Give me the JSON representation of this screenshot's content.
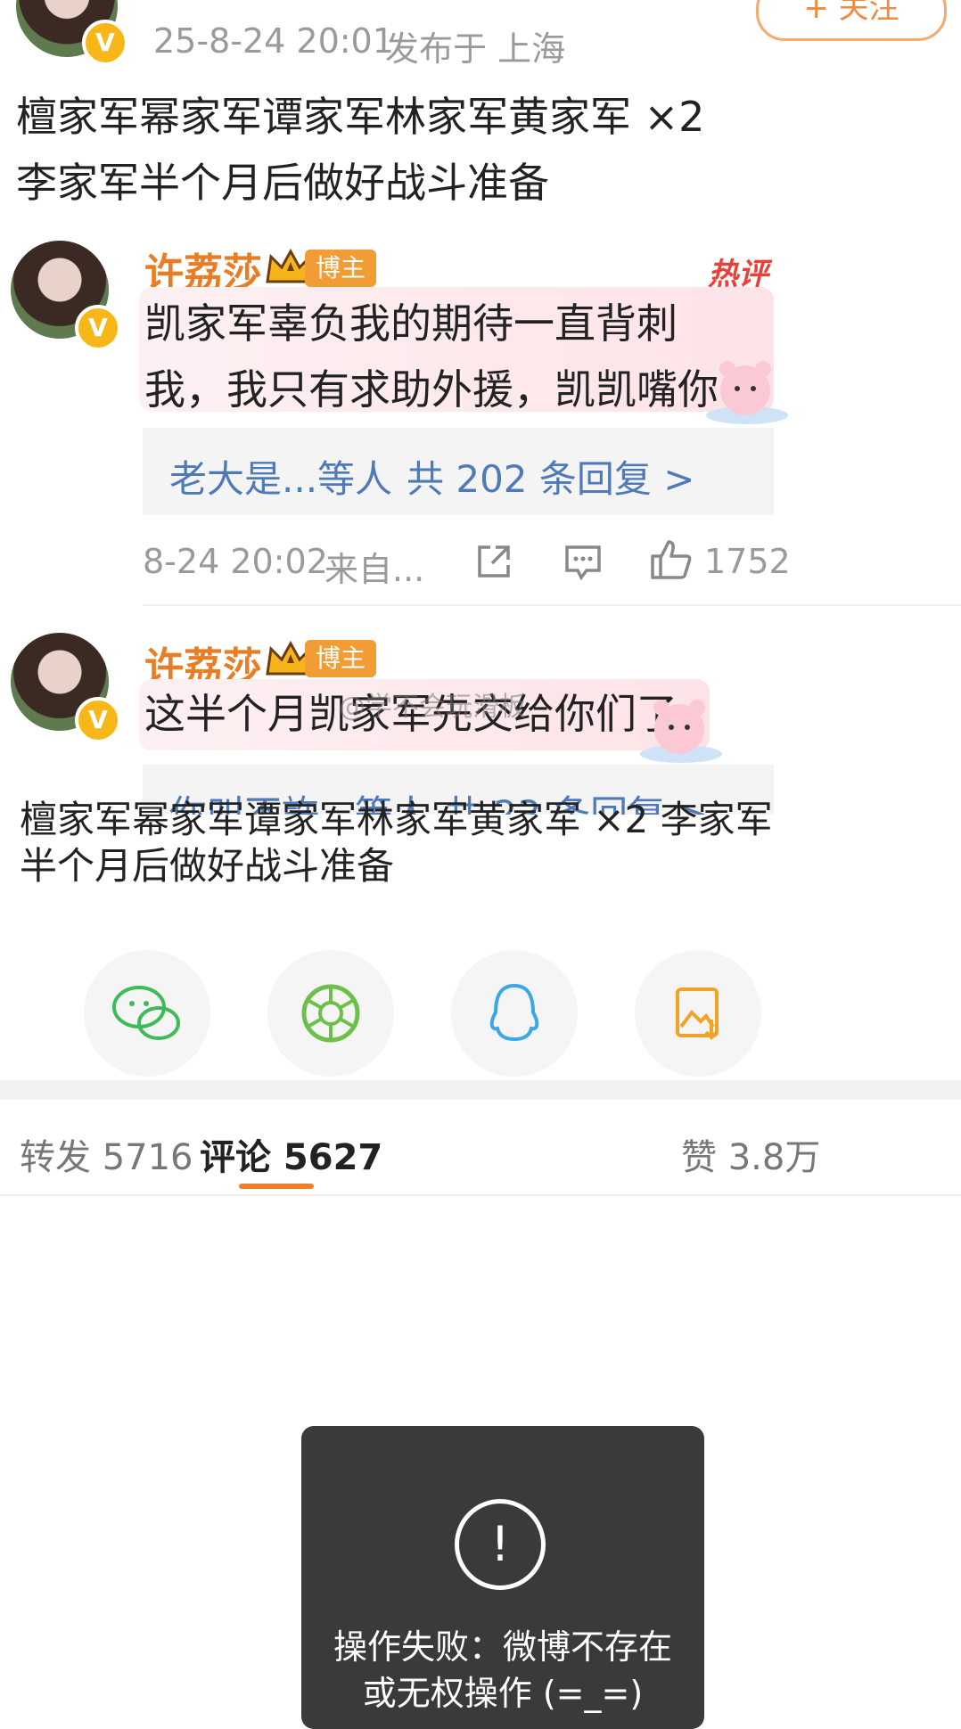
{
  "post": {
    "timestamp": "25-8-24 20:01",
    "location": "发布于 上海",
    "follow_label": "+ 关注",
    "text": "檀家军幂家军谭家军林家军黄家军 ×2 李家军半个月后做好战斗准备"
  },
  "comments": [
    {
      "author": "许荔莎",
      "badge": "博主",
      "hot_label": "热评",
      "text": "凯家军辜负我的期待一直背刺我，我只有求助外援，凯凯嘴你们正主了",
      "replies_preview": "老大是...等人",
      "replies_count": "共 202 条回复 >",
      "time": "8-24 20:02",
      "source": "来自...",
      "likes": "1752"
    },
    {
      "author": "许荔莎",
      "badge": "博主",
      "text": "这半个月凯家军先交给你们了",
      "replies_preview": "你叫不許...等人",
      "replies_count": "共 23 条回复 >"
    }
  ],
  "watermark": "@学不会玩滑板",
  "repost_caption": "檀家军幂家军谭家军林家军黄家军 ×2 李家军半个月后做好战斗准备",
  "share_icons": [
    "wechat-icon",
    "moments-icon",
    "qq-icon",
    "save-image-icon"
  ],
  "tabs": {
    "repost": "转发 5716",
    "comment": "评论 5627",
    "like": "赞 3.8万"
  },
  "toast": {
    "icon": "!",
    "message": "操作失败：微博不存在或无权操作 (=_=)"
  },
  "colors": {
    "name": "#e97d25",
    "link": "#4f7ab8",
    "badge": "#f19c34",
    "verify": "#f7b718"
  }
}
